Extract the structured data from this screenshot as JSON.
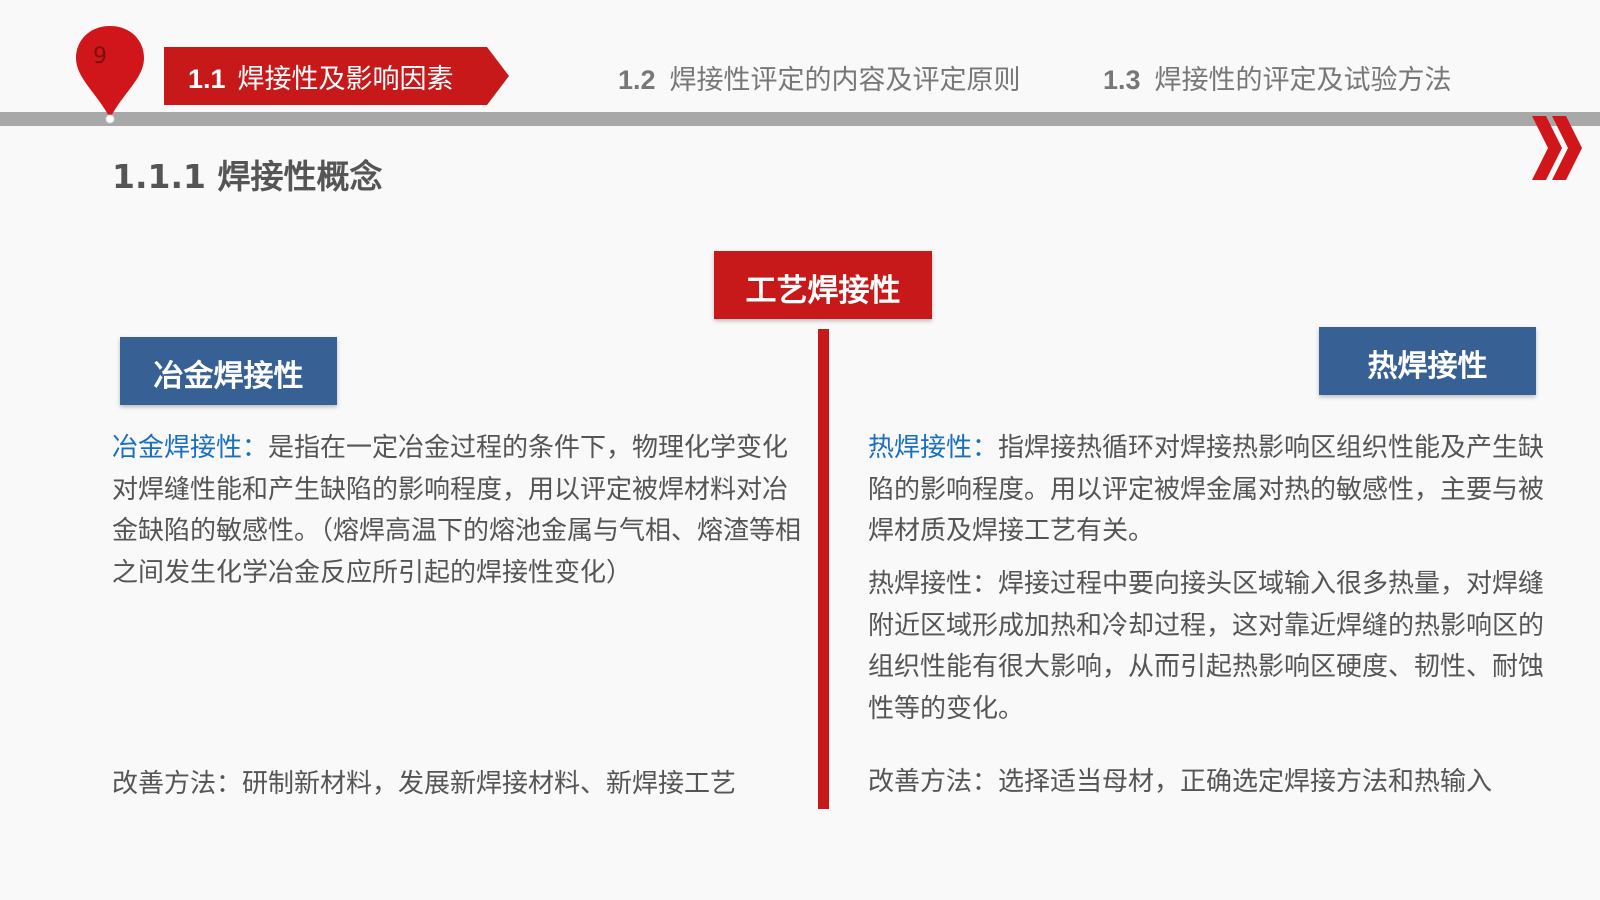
{
  "header": {
    "page_number": "9",
    "tabs": [
      {
        "num": "1.1",
        "label": "焊接性及影响因素"
      },
      {
        "num": "1.2",
        "label": "焊接性评定的内容及评定原则"
      },
      {
        "num": "1.3",
        "label": "焊接性的评定及试验方法"
      }
    ]
  },
  "section_title": "1.1.1 焊接性概念",
  "center": {
    "label": "工艺焊接性"
  },
  "left": {
    "box_label": "冶金焊接性",
    "term": "冶金焊接性：",
    "definition": "是指在一定冶金过程的条件下，物理化学变化对焊缝性能和产生缺陷的影响程度，用以评定被焊材料对冶金缺陷的敏感性。（熔焊高温下的熔池金属与气相、熔渣等相之间发生化学冶金反应所引起的焊接性变化）",
    "improve": "改善方法：研制新材料，发展新焊接材料、新焊接工艺"
  },
  "right": {
    "box_label": "热焊接性",
    "term": "热焊接性：",
    "definition": "指焊接热循环对焊接热影响区组织性能及产生缺陷的影响程度。用以评定被焊金属对热的敏感性，主要与被焊材质及焊接工艺有关。",
    "explanation": "热焊接性：焊接过程中要向接头区域输入很多热量，对焊缝附近区域形成加热和冷却过程，这对靠近焊缝的热影响区的组织性能有很大影响，从而引起热影响区硬度、韧性、耐蚀性等的变化。",
    "improve": "改善方法：选择适当母材，正确选定焊接方法和热输入"
  },
  "colors": {
    "accent_red": "#c8191a",
    "box_blue": "#376094",
    "term_blue": "#1a6fc1",
    "bar_gray": "#a8a8a8"
  },
  "icons": {
    "page_marker": "location-pin-icon",
    "next": "double-chevron-right-icon"
  }
}
